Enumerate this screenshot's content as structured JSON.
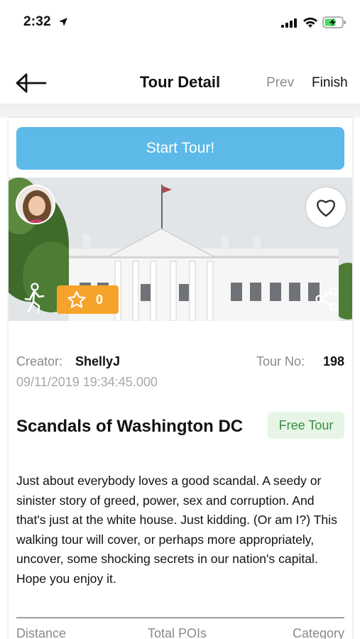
{
  "status_bar": {
    "time": "2:32"
  },
  "nav": {
    "title": "Tour Detail",
    "prev_label": "Prev",
    "finish_label": "Finish"
  },
  "tour": {
    "start_button_label": "Start Tour!",
    "rating_count": "0",
    "creator_label": "Creator:",
    "creator_name": "ShellyJ",
    "tour_no_label": "Tour No:",
    "tour_no": "198",
    "timestamp": "09/11/2019 19:34:45.000",
    "title": "Scandals of Washington DC",
    "price_badge": "Free Tour",
    "description": "Just about everybody loves a good scandal. A seedy or sinister story of greed, power, sex and corruption. And that's just at the white house. Just kidding. (Or am I?)  This walking tour will cover, or perhaps more appropriately, uncover, some shocking secrets in our nation's capital. Hope you enjoy it.",
    "stats_labels": {
      "distance": "Distance",
      "total_pois": "Total POIs",
      "category": "Category"
    }
  },
  "colors": {
    "start_button": "#5db9e8",
    "rating_badge": "#f5a32a",
    "free_badge_bg": "#e6f5e6",
    "free_badge_text": "#3c8c40"
  },
  "icons": {
    "location": "location-arrow-icon",
    "signal": "cellular-signal-icon",
    "wifi": "wifi-icon",
    "battery": "battery-charging-icon",
    "back": "back-arrow-icon",
    "favorite": "heart-icon",
    "walking": "walking-person-icon",
    "rating": "star-icon",
    "share": "share-icon"
  }
}
